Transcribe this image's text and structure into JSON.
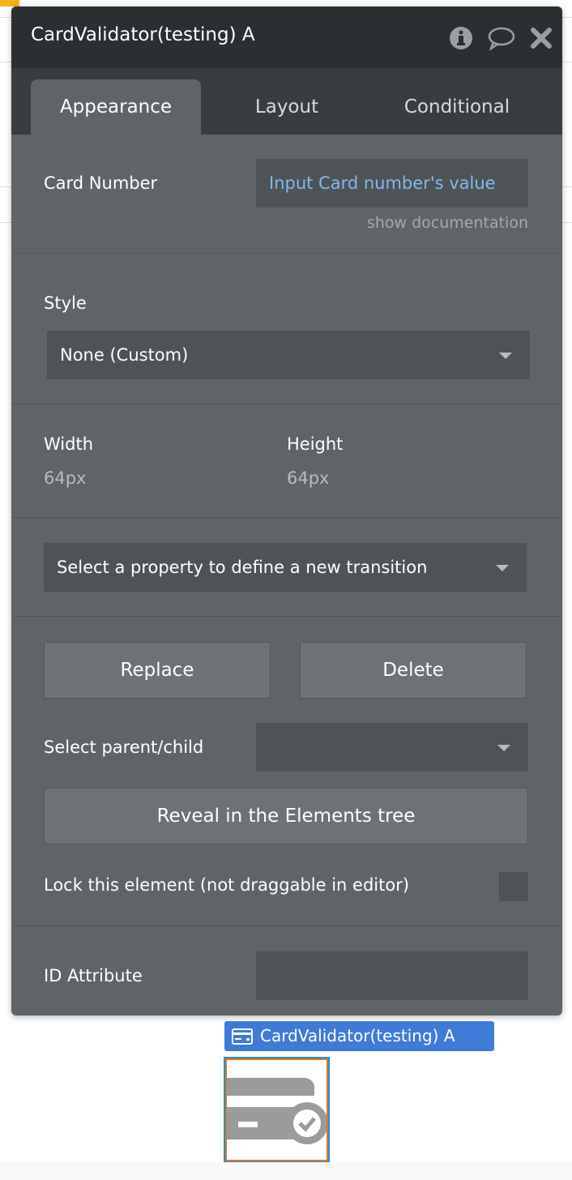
{
  "panel": {
    "title": "CardValidator(testing) A",
    "header_icons": [
      "info-icon",
      "comment-icon",
      "close-icon"
    ],
    "tabs": [
      {
        "label": "Appearance",
        "active": true
      },
      {
        "label": "Layout",
        "active": false
      },
      {
        "label": "Conditional",
        "active": false
      }
    ],
    "card_number": {
      "label": "Card Number",
      "value": "Input Card number's value",
      "doc_link": "show documentation"
    },
    "style": {
      "label": "Style",
      "value": "None (Custom)"
    },
    "width": {
      "label": "Width",
      "value": "64px"
    },
    "height": {
      "label": "Height",
      "value": "64px"
    },
    "transition": {
      "placeholder": "Select a property to define a new transition"
    },
    "replace_label": "Replace",
    "delete_label": "Delete",
    "parent_child": {
      "label": "Select parent/child",
      "value": ""
    },
    "reveal_label": "Reveal in the Elements tree",
    "lock": {
      "label": "Lock this element (not draggable in editor)",
      "checked": false
    },
    "id_attribute": {
      "label": "ID Attribute",
      "value": ""
    }
  },
  "canvas": {
    "element_label": "CardValidator(testing) A",
    "element_icon": "credit-card-check-icon"
  },
  "colors": {
    "accent_link": "#7fb8f5",
    "label_blue": "#3e7bd9",
    "header": "#2a2f31",
    "panel": "#5f6468"
  }
}
